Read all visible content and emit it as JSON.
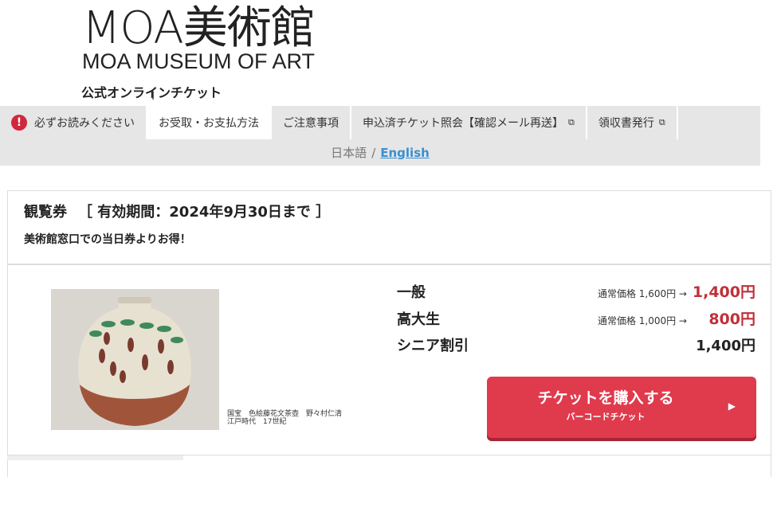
{
  "header": {
    "logo_jp": "MOA美術館",
    "logo_en": "MOA MUSEUM OF ART",
    "subtitle": "公式オンラインチケット"
  },
  "nav": {
    "items": [
      {
        "label": "必ずお読みください",
        "icon": "warning-icon"
      },
      {
        "label": "お受取・お支払方法",
        "active": true
      },
      {
        "label": "ご注意事項"
      },
      {
        "label": "申込済チケット照会【確認メール再送】",
        "icon": "external-link-icon"
      },
      {
        "label": "領収書発行",
        "icon": "external-link-icon"
      }
    ]
  },
  "language": {
    "ja": "日本語",
    "separator": "/",
    "en": "English"
  },
  "ticket": {
    "title": "観覧券",
    "validity": "［ 有効期間：2024年9月30日まで ］",
    "subtitle": "美術館窓口での当日券よりお得！",
    "image_caption_1": "国宝　色絵藤花文茶壺　野々村仁清",
    "image_caption_2": "江戸時代　17世紀",
    "prices": [
      {
        "label": "一般",
        "regular": "通常価格 1,600円 →",
        "price": "1,400円"
      },
      {
        "label": "高大生",
        "regular": "通常価格 1,000円 →",
        "price": "800円"
      },
      {
        "label": "シニア割引",
        "regular": "",
        "price": "1,400円"
      }
    ],
    "buy_button": {
      "label": "チケットを購入する",
      "sublabel": "バーコードチケット",
      "arrow": "▶"
    }
  },
  "colors": {
    "accent_red": "#e03a4d",
    "price_red": "#c0303a",
    "link_blue": "#3a8fd0",
    "nav_bg": "#e6e6e6"
  }
}
